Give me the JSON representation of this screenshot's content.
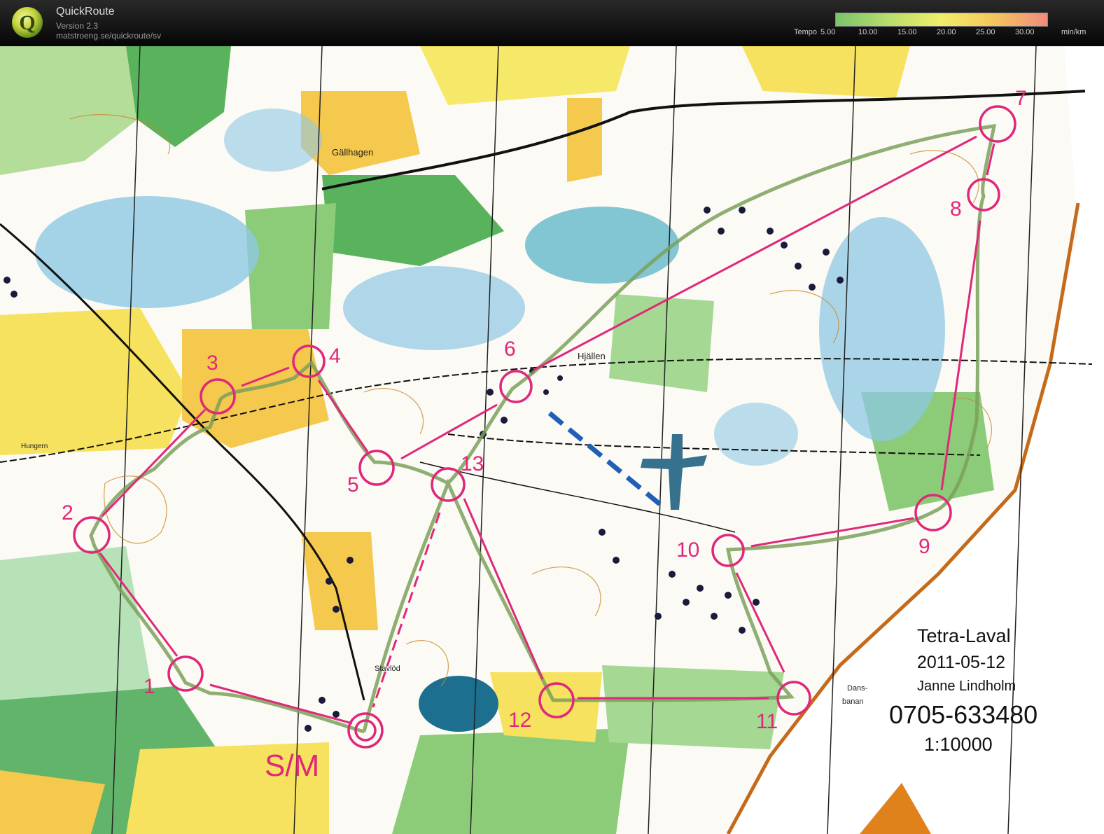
{
  "app": {
    "name": "QuickRoute",
    "version": "Version 2.3",
    "url": "matstroeng.se/quickroute/sv",
    "logo_letter": "Q"
  },
  "tempo_legend": {
    "label": "Tempo",
    "ticks": [
      "5.00",
      "10.00",
      "15.00",
      "20.00",
      "25.00",
      "30.00"
    ],
    "unit": "min/km",
    "gradient_colors": [
      "#7ac46c",
      "#b9dd6b",
      "#f0ee6a",
      "#f4c55d",
      "#f28a7e"
    ]
  },
  "map": {
    "place_names": {
      "gallhagen": "Gällhagen",
      "hjallen": "Hjällen",
      "hungern": "Hungern",
      "stavlod": "Stavlöd",
      "dansbanan_1": "Dans-",
      "dansbanan_2": "banan"
    },
    "controls": [
      {
        "id": "start",
        "label": "S/M"
      },
      {
        "id": "c1",
        "label": "1"
      },
      {
        "id": "c2",
        "label": "2"
      },
      {
        "id": "c3",
        "label": "3"
      },
      {
        "id": "c4",
        "label": "4"
      },
      {
        "id": "c5",
        "label": "5"
      },
      {
        "id": "c6",
        "label": "6"
      },
      {
        "id": "c7",
        "label": "7"
      },
      {
        "id": "c8",
        "label": "8"
      },
      {
        "id": "c9",
        "label": "9"
      },
      {
        "id": "c10",
        "label": "10"
      },
      {
        "id": "c11",
        "label": "11"
      },
      {
        "id": "c12",
        "label": "12"
      },
      {
        "id": "c13",
        "label": "13"
      }
    ],
    "course_color": "#e0287a",
    "route_color": "#7aa05a",
    "info_box": {
      "event": "Tetra-Laval",
      "date": "2011-05-12",
      "author": "Janne Lindholm",
      "phone": "0705-633480",
      "scale": "1:10000"
    }
  }
}
